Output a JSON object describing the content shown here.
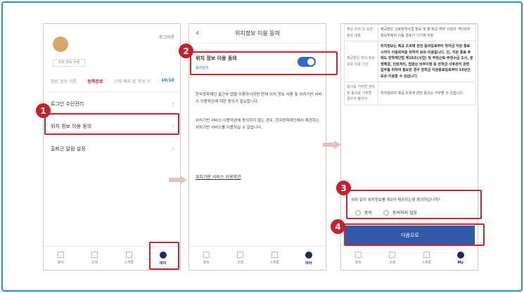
{
  "phone1": {
    "logout": "로그아웃",
    "name_chip": "회원 정보 수정",
    "stats": {
      "label1": "회원 정보 이름",
      "value1": "등록완료",
      "label2": "근태 예외 할 학생 수",
      "value2": "10/10"
    },
    "menu": [
      "로그인 수단관리",
      "위치 정보 이용 동의",
      "출퇴근 알림 설정"
    ],
    "tabs": [
      "출퇴",
      "조회",
      "스케줄",
      "마이"
    ]
  },
  "phone2": {
    "title": "위치정보 이용 동의",
    "consent_title": "위치 정보 이용 동의",
    "consent_date": "동의일자",
    "para1": "한국장학재단 출근부 앱을 이용하시려면 현재 위치 정보 사용 및 위치기반 서비스 이용약관에 대한 동의가 필요합니다.",
    "para2": "위치기반 서비스 이용약관에 동의하지 않는 경우, 한국장학재단에서 제공하는 위치기반 서비스를 이용하실 수 없습니다.",
    "link": "위치기반 서비스 이용약관",
    "tabs": [
      "출퇴",
      "조회",
      "스케줄",
      "마이"
    ]
  },
  "phone3": {
    "rows": [
      {
        "key": "제공·조회 일 보관 정보 내용",
        "value": "제공받은 근로장학사업 정보 및 출·퇴근 여부 시점의 개인위치정보주체의 이동 경로가 기기에 저장"
      },
      {
        "key": "제공받은 자의 정보 보유·이용 기간",
        "value": "위치정보는 제공 조회에 관한 동의일로부터 학자금 지원 종료 시까지 이용목적을 위하여 보유·이용됩니다. 단, 지원 종료 후에도 장학재단법 제16조(사업) 및 부정근로·부정수급 조사, 분쟁해결, 민원처리, 법령상 의무이행 등 장학금 사후관리 관련 업무를 위하여 필요한 경우 장학금 지원종료일로부터 10년간 보유·이용할 수 있습니다."
      },
      {
        "key": "동의를 거부할 권리 및 동의를 거부할 경우의 불이익",
        "value": "위치정보의 제공·조회에 관한 동의는 거부할 수 있습니다."
      }
    ],
    "question": "위와 같이 위치정보를 제3자 제공하는데 동의하십니까?",
    "agree": "동의",
    "disagree": "동의하지 않음",
    "next": "다음으로",
    "tabs": [
      "출퇴",
      "조회",
      "스케줄",
      "My"
    ]
  },
  "badges": [
    "1",
    "2",
    "3",
    "4"
  ],
  "colors": {
    "frame": "#2e8fd0",
    "highlight": "#d9212c",
    "badge": "#c8202a",
    "primary": "#2f5aa8",
    "toggle": "#2c6bd6"
  }
}
